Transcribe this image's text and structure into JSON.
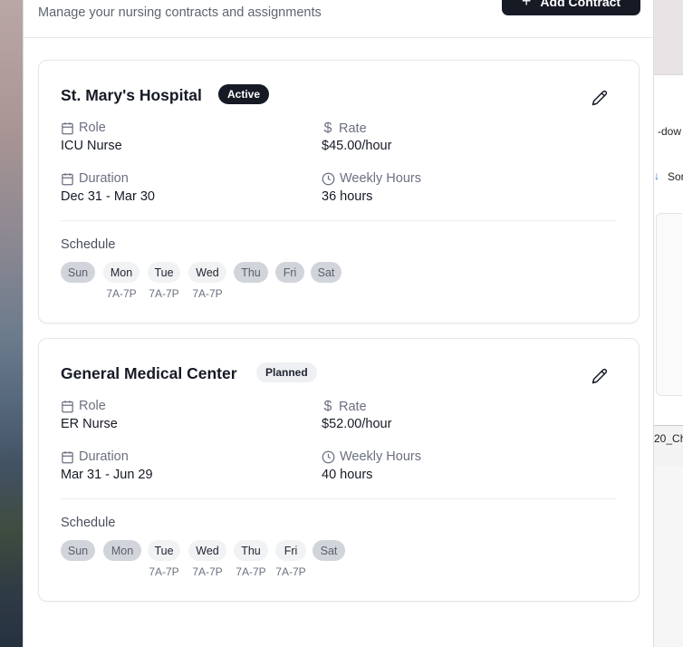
{
  "header": {
    "subtitle": "Manage your nursing contracts and assignments",
    "add_button_label": "Add Contract"
  },
  "field_labels": {
    "role": "Role",
    "rate": "Rate",
    "duration": "Duration",
    "weekly_hours": "Weekly Hours",
    "schedule": "Schedule"
  },
  "contracts": [
    {
      "facility": "St. Mary's Hospital",
      "status": "Active",
      "role": "ICU Nurse",
      "rate": "$45.00/hour",
      "duration": "Dec 31 - Mar 30",
      "weekly_hours": "36 hours",
      "schedule": [
        {
          "day": "Sun",
          "active": false,
          "time": ""
        },
        {
          "day": "Mon",
          "active": true,
          "time": "7A-7P"
        },
        {
          "day": "Tue",
          "active": true,
          "time": "7A-7P"
        },
        {
          "day": "Wed",
          "active": true,
          "time": "7A-7P"
        },
        {
          "day": "Thu",
          "active": false,
          "time": ""
        },
        {
          "day": "Fri",
          "active": false,
          "time": ""
        },
        {
          "day": "Sat",
          "active": false,
          "time": ""
        }
      ]
    },
    {
      "facility": "General Medical Center",
      "status": "Planned",
      "role": "ER Nurse",
      "rate": "$52.00/hour",
      "duration": "Mar 31 - Jun 29",
      "weekly_hours": "40 hours",
      "schedule": [
        {
          "day": "Sun",
          "active": false,
          "time": ""
        },
        {
          "day": "Mon",
          "active": false,
          "time": ""
        },
        {
          "day": "Tue",
          "active": true,
          "time": "7A-7P"
        },
        {
          "day": "Wed",
          "active": true,
          "time": "7A-7P"
        },
        {
          "day": "Thu",
          "active": true,
          "time": "7A-7P"
        },
        {
          "day": "Fri",
          "active": true,
          "time": "7A-7P"
        },
        {
          "day": "Sat",
          "active": false,
          "time": ""
        }
      ]
    }
  ],
  "background_window": {
    "fragments": [
      "-dow",
      "Sor",
      "20_Ch"
    ]
  },
  "colors": {
    "primary": "#161a25",
    "muted_text": "#6b7080",
    "day_off": "#d1d4da",
    "day_on": "#f1f2f4"
  }
}
